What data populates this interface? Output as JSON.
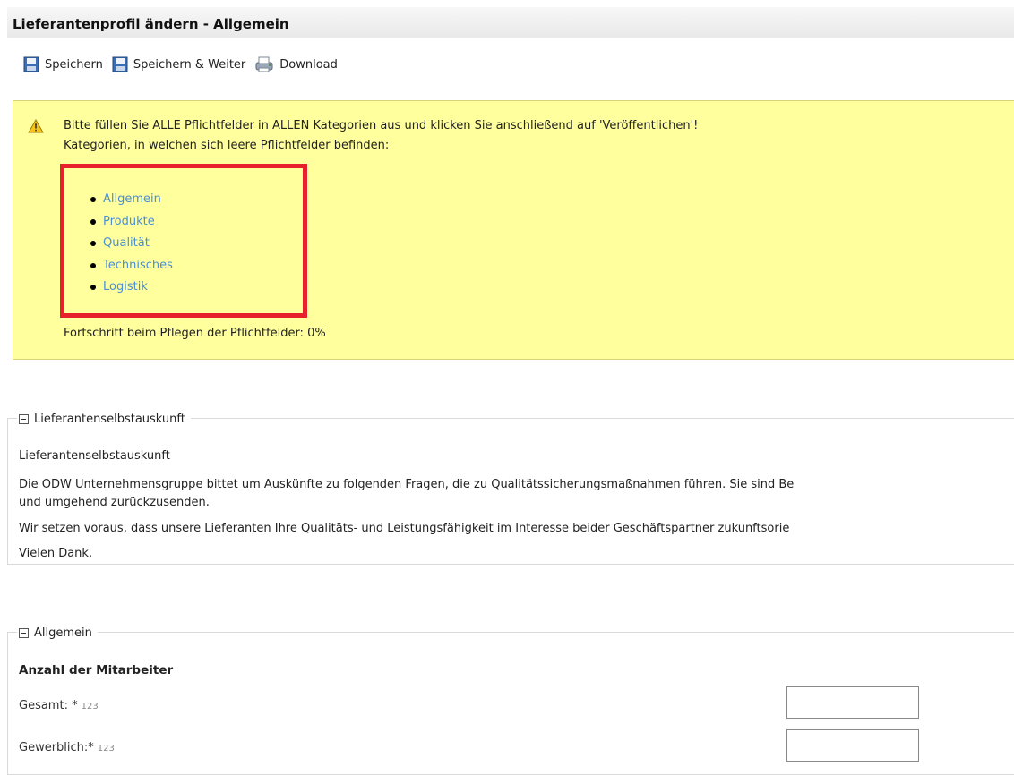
{
  "page": {
    "title": "Lieferantenprofil ändern - Allgemein"
  },
  "toolbar": {
    "save_label": "Speichern",
    "save_next_label": "Speichern & Weiter",
    "download_label": "Download"
  },
  "warning": {
    "line1": "Bitte füllen Sie ALLE Pflichtfelder in ALLEN Kategorien aus und klicken Sie anschließend auf 'Veröffentlichen'!",
    "line2": "Kategorien, in welchen sich leere Pflichtfelder befinden:",
    "categories": [
      "Allgemein",
      "Produkte",
      "Qualität",
      "Technisches",
      "Logistik"
    ],
    "progress": "Fortschritt beim Pflegen der Pflichtfelder: 0%",
    "highlight_color": "#e6212b",
    "background_color": "#ffff9e"
  },
  "section1": {
    "legend": "Lieferantenselbstauskunft",
    "subtitle": "Lieferantenselbstauskunft",
    "para1_line1": "Die ODW Unternehmensgruppe bittet um Auskünfte zu folgenden Fragen, die zu Qualitätssicherungsmaßnahmen führen. Sie sind Be",
    "para1_line2": "und umgehend zurückzusenden.",
    "para2": "Wir setzen voraus, dass unsere Lieferanten Ihre Qualitäts- und Leistungsfähigkeit im Interesse beider Geschäftspartner zukunftsorie",
    "para3": "Vielen Dank."
  },
  "section2": {
    "legend": "Allgemein",
    "heading": "Anzahl der Mitarbeiter",
    "fields": [
      {
        "label": "Gesamt: *",
        "hint": "123",
        "value": ""
      },
      {
        "label": "Gewerblich:*",
        "hint": "123",
        "value": ""
      }
    ]
  }
}
